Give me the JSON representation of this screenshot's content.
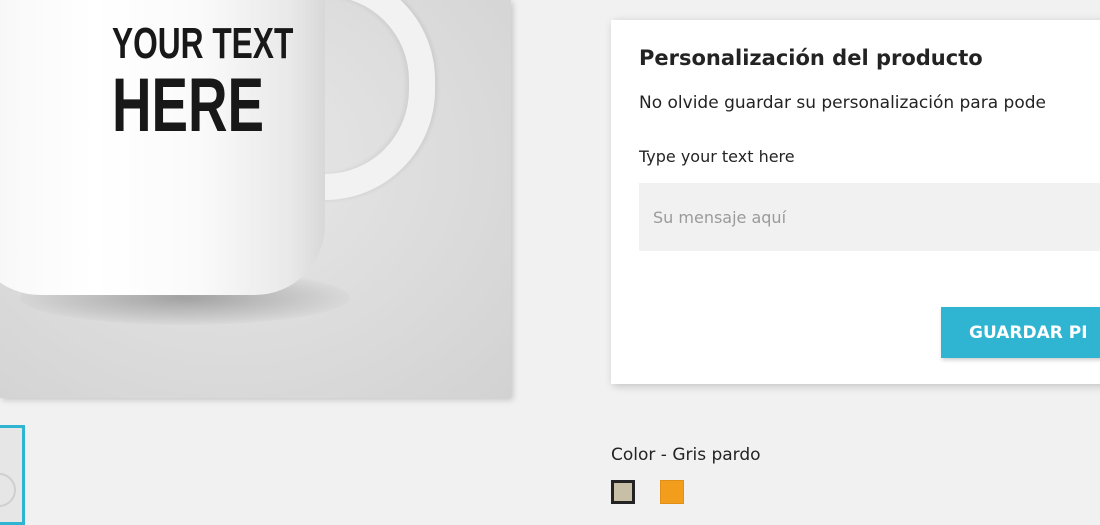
{
  "product_image": {
    "mug_text_line1": "YOUR TEXT",
    "mug_text_line2": "HERE"
  },
  "customization": {
    "title": "Personalización del producto",
    "notice": "No olvide guardar su personalización para pode",
    "field_label": "Type your text here",
    "input_value": "",
    "input_placeholder": "Su mensaje aquí",
    "save_button_label": "GUARDAR PI"
  },
  "color": {
    "label": "Color - Gris pardo",
    "swatches": [
      {
        "name": "Gris pardo",
        "hex": "#c8bfa7",
        "selected": true
      },
      {
        "name": "Naranja",
        "hex": "#f39d1c",
        "selected": false
      }
    ]
  },
  "colors": {
    "accent": "#2fb5d2",
    "background": "#f1f1f1",
    "card": "#ffffff",
    "text": "#232323"
  }
}
